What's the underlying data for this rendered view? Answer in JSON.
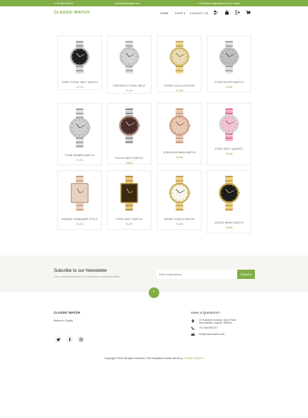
{
  "colors": {
    "accent": "#82ae46",
    "text": "#333333",
    "newsletter_bg": "#f6f5f1"
  },
  "topbar": {
    "phone": "+91 8452952747",
    "email": "info@classicwatch.com",
    "shipping": "3-5 Business days delivery & free returns"
  },
  "nav": {
    "logo": "CLASSIC WATCH",
    "home": "HOME",
    "shop": "SHOP",
    "contact": "CONTACT US",
    "icons": [
      "user-add-icon",
      "bag-icon",
      "logout-icon",
      "cart-icon"
    ]
  },
  "products": [
    {
      "name": "TIMEX STEEL BELT WATCH",
      "price": "₹1795",
      "style": "black-silver"
    },
    {
      "name": "FASTRACK STAIN. BELT",
      "price": "₹1499",
      "style": "silver"
    },
    {
      "name": "FOSSIL GOLD EDITION",
      "price": "₹7099",
      "style": "gold"
    },
    {
      "name": "TITAN SILVER WATCH",
      "price": "₹1695",
      "style": "silver-large"
    },
    {
      "name": "TITAN WOMEN WATCH",
      "price": "₹1795",
      "style": "silver-women"
    },
    {
      "name": "ROLEX BELT WATCH",
      "price": "₹5999",
      "style": "rose-small"
    },
    {
      "name": "SONATA WOMAN WATCH",
      "price": "₹1899",
      "style": "rose-gold"
    },
    {
      "name": "STEEL BELT QUARTZ",
      "price": "₹1599",
      "style": "pink"
    },
    {
      "name": "SONATA STANDARD STYLE",
      "price": "₹1499",
      "style": "rose-rect"
    },
    {
      "name": "STEEL BELT WATCH",
      "price": "₹1699",
      "style": "gold-rect"
    },
    {
      "name": "BRIDE COACH WATCH",
      "price": "₹1050",
      "style": "gold-white"
    },
    {
      "name": "GUESS MENS WATCH",
      "price": "₹5999",
      "style": "gold-black"
    }
  ],
  "newsletter": {
    "title": "Subcribe to our Newsletter",
    "subtitle": "Get e-mail updates about our latest shops and special offers",
    "placeholder": "Enter email address",
    "button": "Subscribe"
  },
  "footer": {
    "brand": "CLASSIC WATCH",
    "tagline": "Believe in Quality",
    "questions_title": "Have a Questions?",
    "address": "22 Sunplaze Industry, Near Podar, Ahmedabad, Gujarat, 380009.",
    "phone": "+91 8452952747",
    "email": "info@classicwatch.com",
    "social": [
      "twitter-icon",
      "facebook-icon",
      "instagram-icon"
    ],
    "copyright_prefix": "Copyright ©2022 All rights reserved | This template is made with",
    "copyright_by": "by",
    "copyright_brand": "CLASSIC WATCH"
  }
}
